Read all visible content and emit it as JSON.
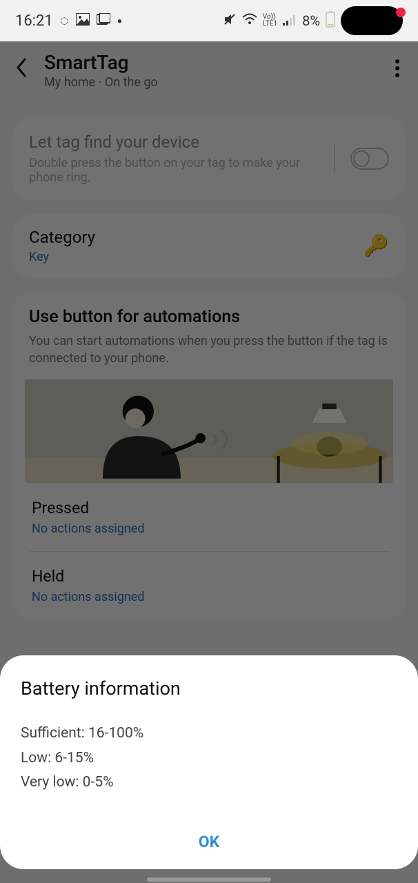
{
  "statusbar": {
    "time": "16:21",
    "battery_text": "8%",
    "network_text": "LTE1"
  },
  "header": {
    "title": "SmartTag",
    "subtitle": "My home · On the go"
  },
  "find_card": {
    "title": "Let tag find your device",
    "desc": "Double press the button on your tag to make your phone ring."
  },
  "category_card": {
    "title": "Category",
    "value": "Key"
  },
  "automations": {
    "title": "Use button for automations",
    "desc": "You can start automations when you press the button if the tag is connected to your phone.",
    "pressed_label": "Pressed",
    "pressed_value": "No actions assigned",
    "held_label": "Held",
    "held_value": "No actions assigned"
  },
  "dialog": {
    "title": "Battery information",
    "line1": "Sufficient: 16-100%",
    "line2": "Low: 6-15%",
    "line3": "Very low: 0-5%",
    "ok": "OK"
  }
}
